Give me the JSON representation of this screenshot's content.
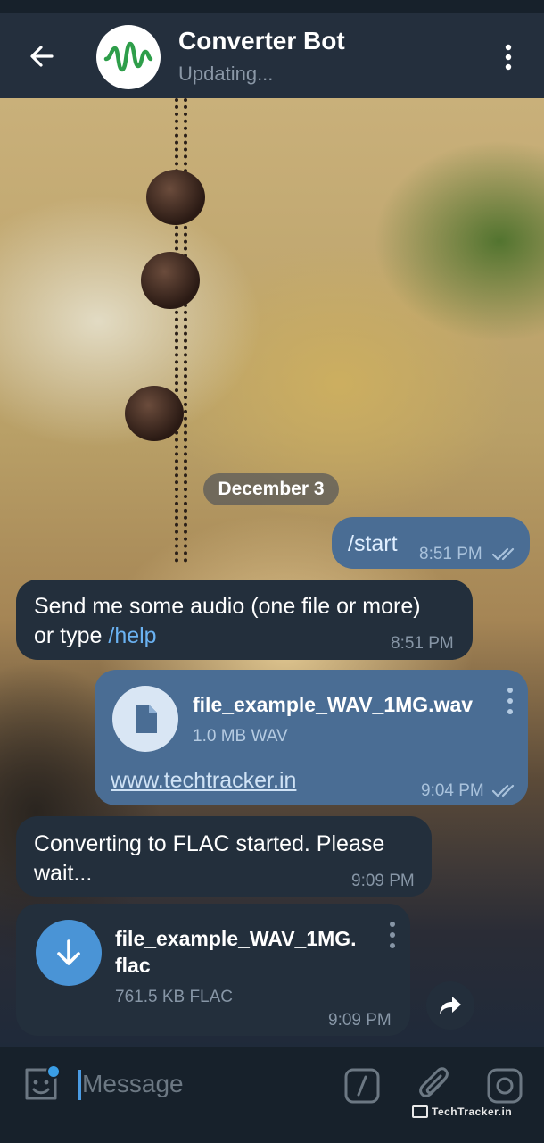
{
  "header": {
    "title": "Converter Bot",
    "subtitle": "Updating...",
    "avatar_color": "#2e9e4a"
  },
  "date_separator": "December 3",
  "messages": [
    {
      "direction": "outgoing",
      "text": "/start",
      "time": "8:51 PM",
      "read": true
    },
    {
      "direction": "incoming",
      "text_prefix": "Send me some audio (one file or more)",
      "text_line2": "or type ",
      "link": "/help",
      "time": "8:51 PM"
    },
    {
      "direction": "outgoing",
      "type": "file",
      "file_name": "file_example_WAV_1MG.wav",
      "file_meta": "1.0 MB WAV",
      "caption_link": "www.techtracker.in",
      "time": "9:04 PM",
      "read": true,
      "icon": "document-icon"
    },
    {
      "direction": "incoming",
      "text_line1": "Converting to FLAC started. Please",
      "text_line2": "wait...",
      "time": "9:09 PM"
    },
    {
      "direction": "incoming",
      "type": "file",
      "file_name_line1": "file_example_WAV_1MG.",
      "file_name_line2": "flac",
      "file_meta": "761.5 KB FLAC",
      "time": "9:09 PM",
      "icon": "download-icon"
    }
  ],
  "input": {
    "placeholder": "Message"
  },
  "watermark": "TechTracker.in",
  "colors": {
    "header_bg": "#242f3d",
    "outgoing_bubble": "#4a6d94",
    "incoming_bubble": "#232f3c",
    "link": "#6ab2f2",
    "accent": "#3a9ee6"
  }
}
